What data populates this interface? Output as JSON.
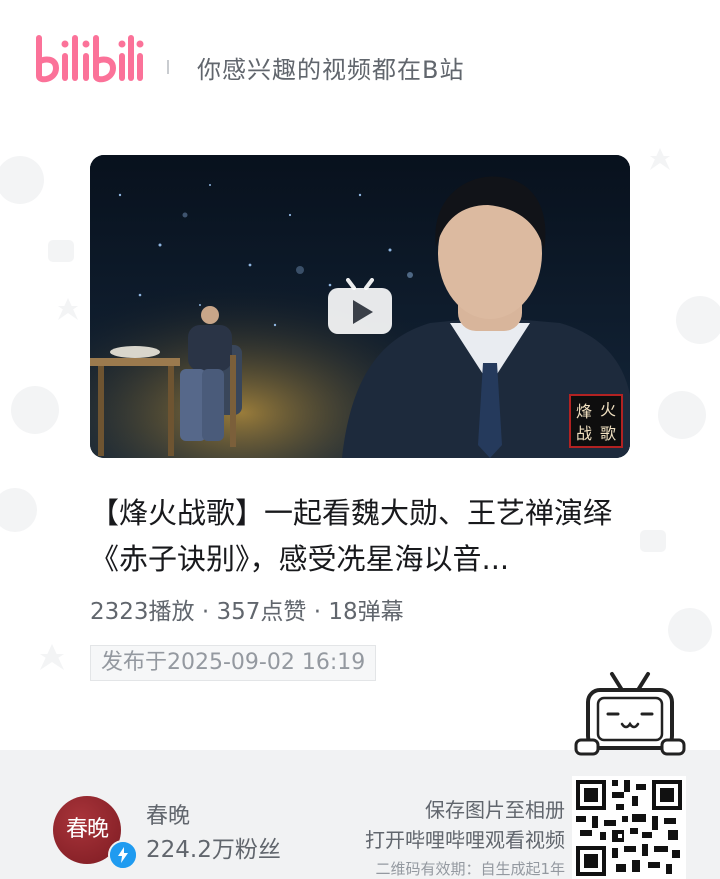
{
  "header": {
    "logo_text": "bilibili",
    "slogan": "你感兴趣的视频都在B站"
  },
  "video": {
    "badge_text": [
      "烽",
      "火",
      "战",
      "歌"
    ],
    "title": "【烽火战歌】一起看魏大勋、王艺禅演绎《赤子诀别》，感受冼星海以音...",
    "plays": "2323播放",
    "likes": "357点赞",
    "danmaku": "18弹幕",
    "separator": " · ",
    "publish_time": "发布于2025-09-02 16:19"
  },
  "uploader": {
    "avatar_text": "春晚",
    "name": "春晚",
    "fans": "224.2万粉丝"
  },
  "footer": {
    "save_hint": "保存图片至相册",
    "open_hint": "打开哔哩哔哩观看视频",
    "validity": "二维码有效期：自生成起1年"
  },
  "colors": {
    "brand_pink": "#fb7299",
    "verify_blue": "#1f9bf0",
    "text_primary": "#18191c",
    "text_secondary": "#61666d",
    "footer_bg": "#f1f2f3"
  },
  "icons": [
    "bilibili-logo",
    "play-icon",
    "tv-mascot-icon",
    "verified-icon",
    "qr-code"
  ]
}
